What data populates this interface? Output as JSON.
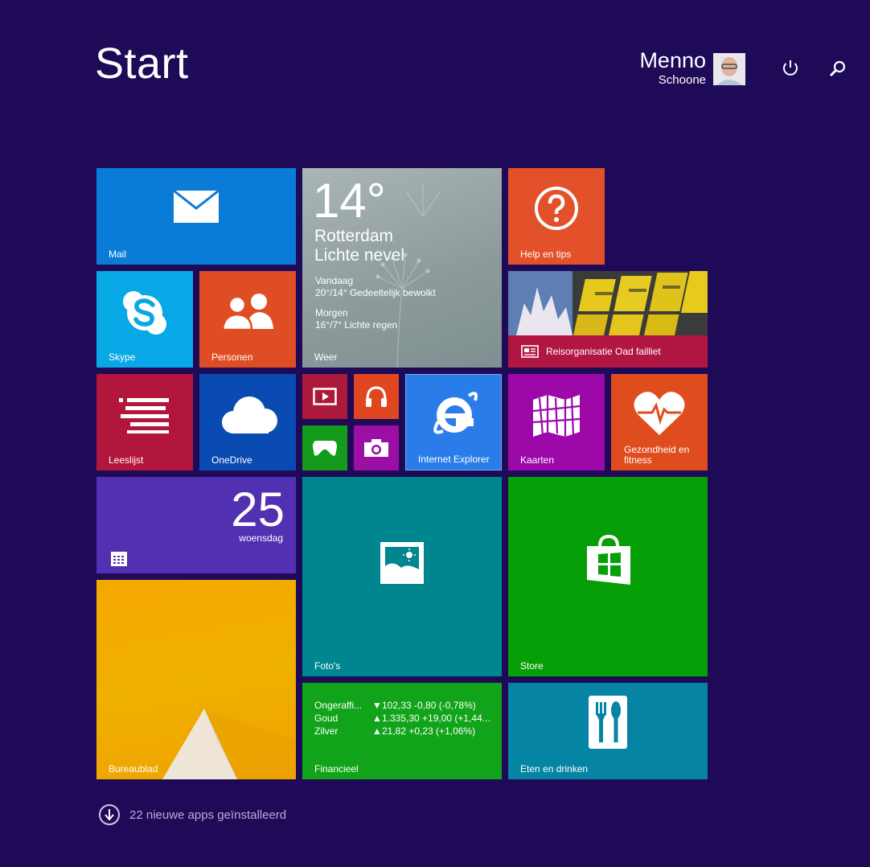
{
  "header": {
    "title": "Start"
  },
  "user": {
    "first_name": "Menno",
    "last_name": "Schoone"
  },
  "icons": {
    "power": "power-icon",
    "search": "search-icon"
  },
  "colors": {
    "background": "#1f0a58",
    "mail": "#0a7bd7",
    "weather": "#9aa8a8",
    "help": "#e3512a",
    "skype": "#08a8e6",
    "personen": "#df4d24",
    "leeslijst": "#b3163d",
    "onedrive": "#0a4bb3",
    "video": "#ab1a3a",
    "muziek": "#e0461f",
    "games": "#159b1c",
    "camera": "#9b0fa4",
    "ie": "#2a7ce9",
    "kaarten": "#9c09a8",
    "gezondheid": "#df4d1f",
    "agenda": "#5130b2",
    "fotos": "#00868f",
    "store": "#079f07",
    "bureaublad": "#f0a800",
    "financieel": "#11a41a",
    "eten": "#0584a3",
    "nieuws": "#b11643"
  },
  "tiles": {
    "mail": {
      "label": "Mail",
      "icon": "mail-icon"
    },
    "weather": {
      "label": "Weer",
      "temperature": "14°",
      "city": "Rotterdam",
      "condition": "Lichte nevel",
      "today_label": "Vandaag",
      "today_forecast": "20°/14° Gedeeltelijk bewolkt",
      "tomorrow_label": "Morgen",
      "tomorrow_forecast": "16°/7° Lichte regen"
    },
    "help": {
      "label": "Help en tips",
      "icon": "question-icon"
    },
    "skype": {
      "label": "Skype",
      "icon": "skype-icon"
    },
    "personen": {
      "label": "Personen",
      "icon": "people-icon"
    },
    "nieuws": {
      "headline": "Reisorganisatie Oad failliet",
      "icon": "newspaper-icon"
    },
    "leeslijst": {
      "label": "Leeslijst",
      "icon": "reading-list-icon"
    },
    "onedrive": {
      "label": "OneDrive",
      "icon": "cloud-icon"
    },
    "video": {
      "icon": "video-icon"
    },
    "muziek": {
      "icon": "headphones-icon"
    },
    "games": {
      "icon": "gamepad-icon"
    },
    "camera": {
      "icon": "camera-icon"
    },
    "ie": {
      "label": "Internet Explorer",
      "icon": "internet-explorer-icon"
    },
    "kaarten": {
      "label": "Kaarten",
      "icon": "map-icon"
    },
    "gezondheid": {
      "label": "Gezondheid en fitness",
      "icon": "heart-icon"
    },
    "agenda": {
      "day": "25",
      "weekday": "woensdag",
      "icon": "calendar-icon"
    },
    "fotos": {
      "label": "Foto's",
      "icon": "photo-icon"
    },
    "store": {
      "label": "Store",
      "icon": "store-icon"
    },
    "bureaublad": {
      "label": "Bureaublad"
    },
    "financieel": {
      "label": "Financieel",
      "rows": [
        {
          "name": "Ongeraffi...",
          "direction": "down",
          "value": "102,33 -0,80 (-0,78%)"
        },
        {
          "name": "Goud",
          "direction": "up",
          "value": "1.335,30 +19,00 (+1,44..."
        },
        {
          "name": "Zilver",
          "direction": "up",
          "value": "21,82 +0,23 (+1,06%)"
        }
      ]
    },
    "eten": {
      "label": "Eten en drinken",
      "icon": "food-icon"
    }
  },
  "footer": {
    "text": "22 nieuwe apps geïnstalleerd",
    "icon": "arrow-down-circle-icon"
  }
}
